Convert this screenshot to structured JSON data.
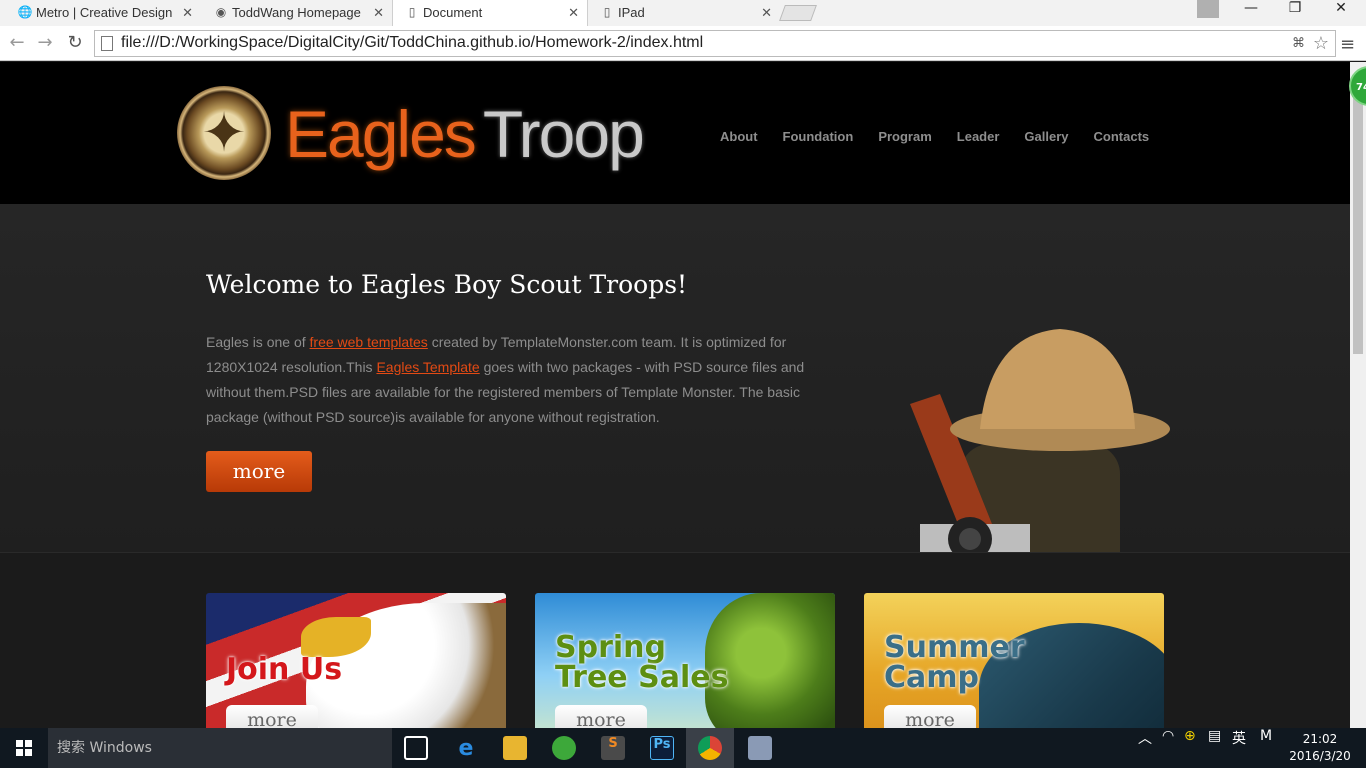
{
  "browser": {
    "tabs": [
      {
        "label": "Metro | Creative Design",
        "icon": "globe-icon"
      },
      {
        "label": "ToddWang Homepage",
        "icon": "avatar-icon"
      },
      {
        "label": "Document",
        "icon": "page-icon"
      },
      {
        "label": "IPad",
        "icon": "page-icon"
      }
    ],
    "url": "file:///D:/WorkingSpace/DigitalCity/Git/ToddChina.github.io/Homework-2/index.html",
    "extension_badge": "74"
  },
  "site": {
    "logo_part1": "Eagles",
    "logo_part2": "Troop",
    "nav": [
      "About",
      "Foundation",
      "Program",
      "Leader",
      "Gallery",
      "Contacts"
    ],
    "hero": {
      "title": "Welcome to Eagles Boy Scout Troops!",
      "text_1": "Eagles is one of ",
      "link_1": "free web templates",
      "text_2": " created by TemplateMonster.com team. It is optimized for 1280X1024 resolution.This ",
      "link_2": "Eagles Template",
      "text_3": " goes with two packages - with PSD source files and without them.PSD files are available for the registered members of Template Monster. The basic package (without PSD source)is available for anyone without registration.",
      "more_label": "more"
    },
    "cards": [
      {
        "title": "Join Us",
        "button": "more"
      },
      {
        "title": "Spring\nTree Sales",
        "button": "more"
      },
      {
        "title": "Summer\nCamp",
        "button": "more"
      }
    ]
  },
  "taskbar": {
    "search_placeholder": "搜索 Windows",
    "ime_lang": "英",
    "ime_mode": "M",
    "time": "21:02",
    "date": "2016/3/20",
    "photoshop_label": "Ps",
    "sublime_label": "S"
  },
  "colors": {
    "accent": "#e45c1b",
    "link": "#e34a14"
  }
}
